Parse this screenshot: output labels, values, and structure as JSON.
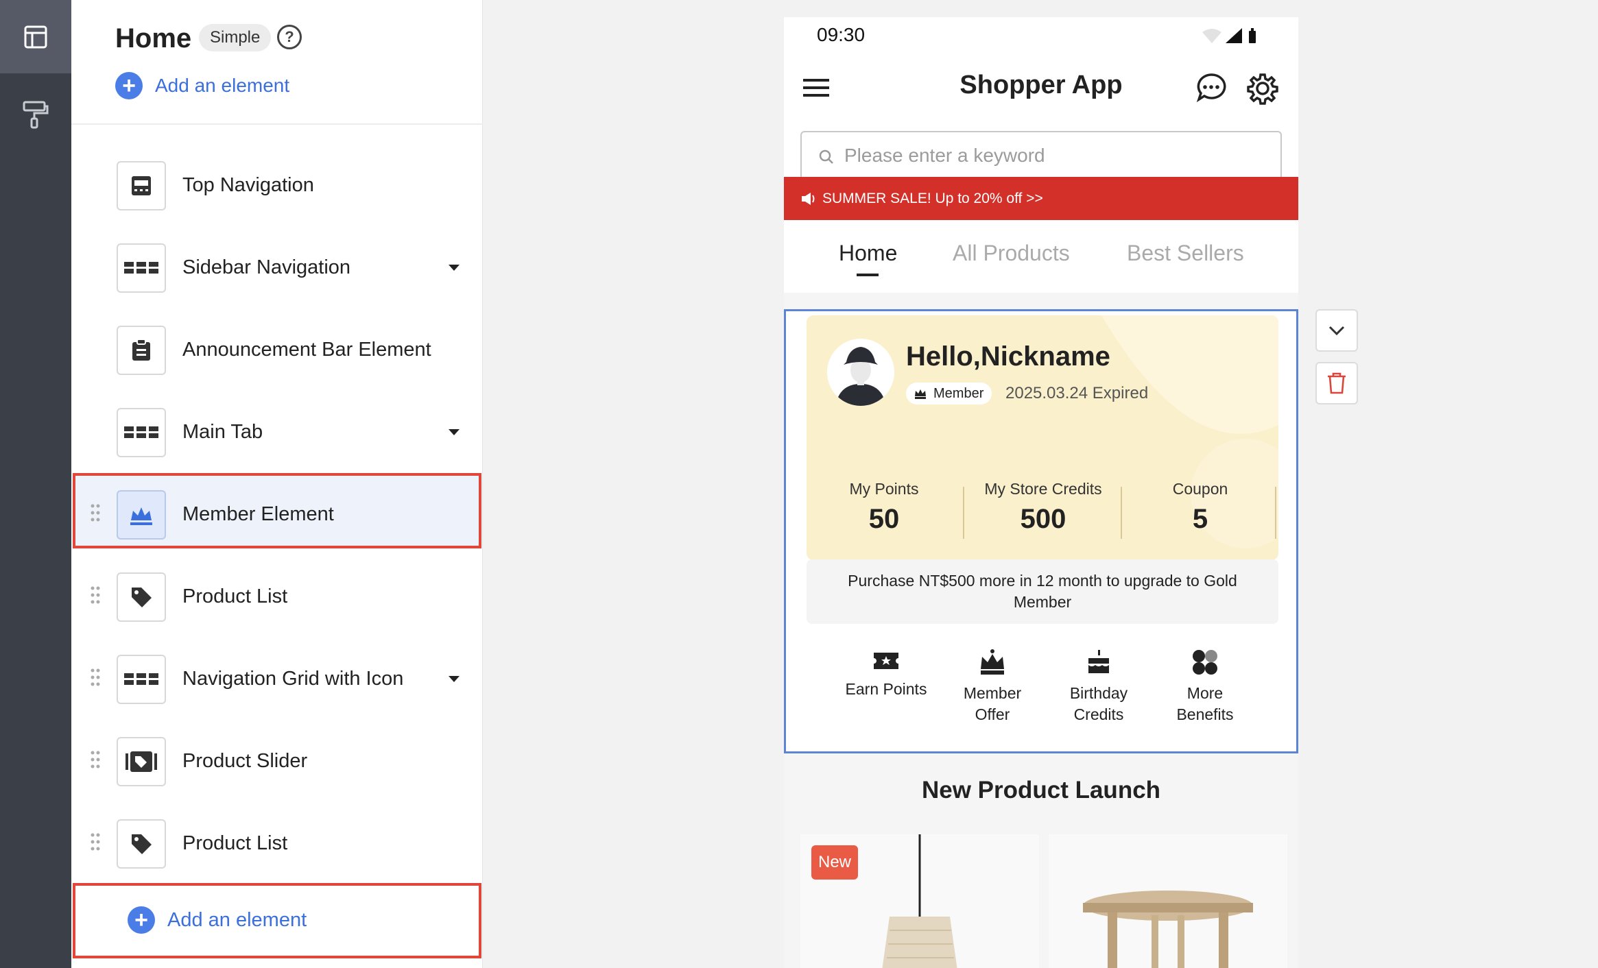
{
  "rail": {
    "items": [
      {
        "icon": "layout-icon"
      },
      {
        "icon": "paint-roller-icon"
      }
    ]
  },
  "panel": {
    "title": "Home",
    "mode_badge": "Simple",
    "help": "?",
    "add_top": "Add an element",
    "items": [
      {
        "label": "Top Navigation",
        "icon": "top-nav-icon"
      },
      {
        "label": "Sidebar Navigation",
        "icon": "grid-bars-icon"
      },
      {
        "label": "Announcement Bar Element",
        "icon": "clipboard-icon"
      },
      {
        "label": "Main Tab",
        "icon": "grid-bars-icon"
      },
      {
        "label": "Member Element",
        "icon": "crown-icon",
        "selected": true
      },
      {
        "label": "Product List",
        "icon": "tag-icon"
      },
      {
        "label": "Navigation Grid with Icon",
        "icon": "grid-bars-icon"
      },
      {
        "label": "Product Slider",
        "icon": "slider-icon"
      },
      {
        "label": "Product List",
        "icon": "tag-icon"
      }
    ],
    "add_bottom": "Add an element"
  },
  "phone": {
    "time": "09:30",
    "app_title": "Shopper App",
    "search_placeholder": "Please enter a keyword",
    "promo": "SUMMER SALE! Up to 20% off >>",
    "tabs": [
      "Home",
      "All Products",
      "Best Sellers"
    ],
    "active_tab": "Home",
    "member": {
      "greeting": "Hello,Nickname",
      "badge": "Member",
      "expiry": "2025.03.24 Expired",
      "stats": [
        {
          "label": "My Points",
          "value": "50"
        },
        {
          "label": "My Store Credits",
          "value": "500"
        },
        {
          "label": "Coupon",
          "value": "5"
        }
      ],
      "upgrade_line1": "Purchase NT$500 more in 12 month to upgrade to Gold",
      "upgrade_line2": "Member",
      "benefits": [
        {
          "line1": "Earn Points",
          "line2": "",
          "icon": "ticket-star-icon"
        },
        {
          "line1": "Member",
          "line2": "Offer",
          "icon": "crown-icon"
        },
        {
          "line1": "Birthday",
          "line2": "Credits",
          "icon": "cake-icon"
        },
        {
          "line1": "More",
          "line2": "Benefits",
          "icon": "clover-icon"
        }
      ]
    },
    "section_title": "New Product Launch",
    "new_tag": "New"
  },
  "colors": {
    "accent": "#3b6fdc",
    "selection": "#e0463a",
    "promo": "#d4302a",
    "member_card": "#fbf0cc",
    "frame": "#5b84d6"
  }
}
